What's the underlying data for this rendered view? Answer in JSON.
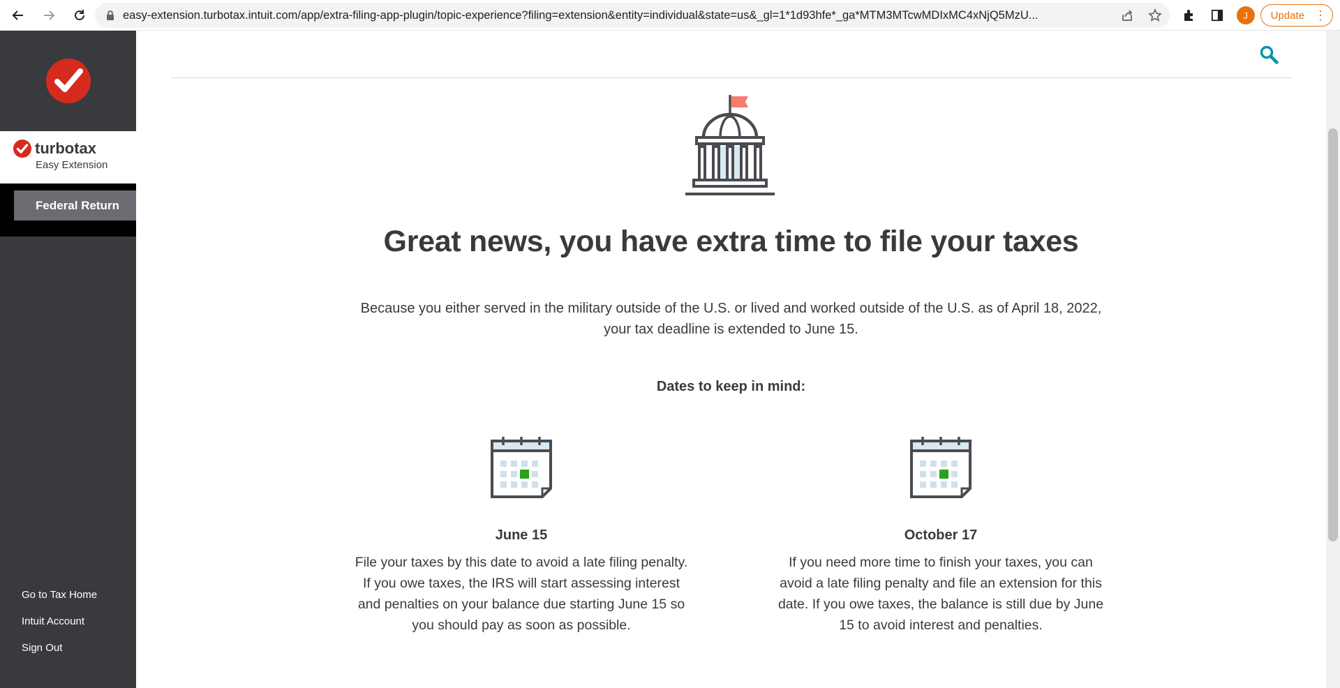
{
  "browser": {
    "url": "easy-extension.turbotax.intuit.com/app/extra-filing-app-plugin/topic-experience?filing=extension&entity=individual&state=us&_gl=1*1d93hfe*_ga*MTM3MTcwMDIxMC4xNjQ5MzU...",
    "avatar_initial": "J",
    "update_label": "Update"
  },
  "sidebar": {
    "brand_name": "turbotax",
    "brand_sub": "Easy Extension",
    "federal_return": "Federal Return",
    "links": [
      "Go to Tax Home",
      "Intuit Account",
      "Sign Out"
    ]
  },
  "main": {
    "headline": "Great news, you have extra time to file your taxes",
    "intro_line1": "Because you either served in the military outside of the U.S. or lived and worked outside of the U.S. as of April 18, 2022,",
    "intro_line2": "your tax deadline is extended to June 15.",
    "dates_heading": "Dates to keep in mind:",
    "dates": [
      {
        "title": "June 15",
        "lines": [
          "File your taxes by this date to avoid a late filing penalty.",
          "If you owe taxes, the IRS will start assessing interest",
          "and penalties on your balance due starting June 15 so",
          "you should pay as soon as possible."
        ]
      },
      {
        "title": "October 17",
        "lines": [
          "If you need more time to finish your taxes, you can",
          "avoid a late filing penalty and file an extension for this",
          "date. If you owe taxes, the balance is still due by June",
          "15 to avoid interest and penalties."
        ]
      }
    ]
  },
  "colors": {
    "sidebar_bg": "#393a3d",
    "brand_red": "#d52b1e",
    "accent_teal": "#0097a7",
    "calendar_green": "#2ca01c",
    "flag_coral": "#f47c6c"
  }
}
